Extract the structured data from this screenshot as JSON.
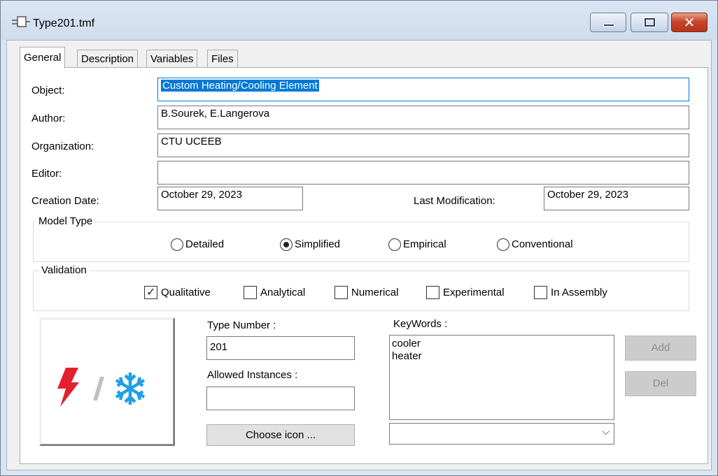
{
  "window": {
    "title": "Type201.tmf",
    "icon": "tmf-file-icon",
    "controls": {
      "minimize": "minimize-icon",
      "maximize": "maximize-icon",
      "close": "close-icon"
    }
  },
  "tabs": [
    {
      "label": "General",
      "active": true
    },
    {
      "label": "Description",
      "active": false
    },
    {
      "label": "Variables",
      "active": false
    },
    {
      "label": "Files",
      "active": false
    }
  ],
  "general": {
    "object_label": "Object:",
    "object_value": "Custom Heating/Cooling Element",
    "author_label": "Author:",
    "author_value": "B.Sourek, E.Langerova",
    "organization_label": "Organization:",
    "organization_value": "CTU UCEEB",
    "editor_label": "Editor:",
    "editor_value": "",
    "creation_date_label": "Creation Date:",
    "creation_date_value": "October 29, 2023",
    "last_modification_label": "Last Modification:",
    "last_modification_value": "October 29, 2023"
  },
  "model_type": {
    "title": "Model Type",
    "options": [
      {
        "label": "Detailed",
        "selected": false
      },
      {
        "label": "Simplified",
        "selected": true
      },
      {
        "label": "Empirical",
        "selected": false
      },
      {
        "label": "Conventional",
        "selected": false
      }
    ]
  },
  "validation": {
    "title": "Validation",
    "options": [
      {
        "label": "Qualitative",
        "checked": true
      },
      {
        "label": "Analytical",
        "checked": false
      },
      {
        "label": "Numerical",
        "checked": false
      },
      {
        "label": "Experimental",
        "checked": false
      },
      {
        "label": "In Assembly",
        "checked": false
      }
    ]
  },
  "icon_area": {
    "icons": [
      "lightning-icon",
      "slash-divider-icon",
      "snowflake-icon"
    ],
    "choose_icon_label": "Choose icon ..."
  },
  "type_number": {
    "label": "Type Number :",
    "value": "201"
  },
  "allowed_instances": {
    "label": "Allowed Instances :",
    "value": ""
  },
  "keywords": {
    "label": "KeyWords :",
    "items": [
      "cooler",
      "heater"
    ],
    "add_label": "Add",
    "del_label": "Del",
    "combo_value": ""
  },
  "colors": {
    "selection": "#0078d7",
    "lightning": "#e5202e",
    "snowflake": "#1fa0e6"
  }
}
